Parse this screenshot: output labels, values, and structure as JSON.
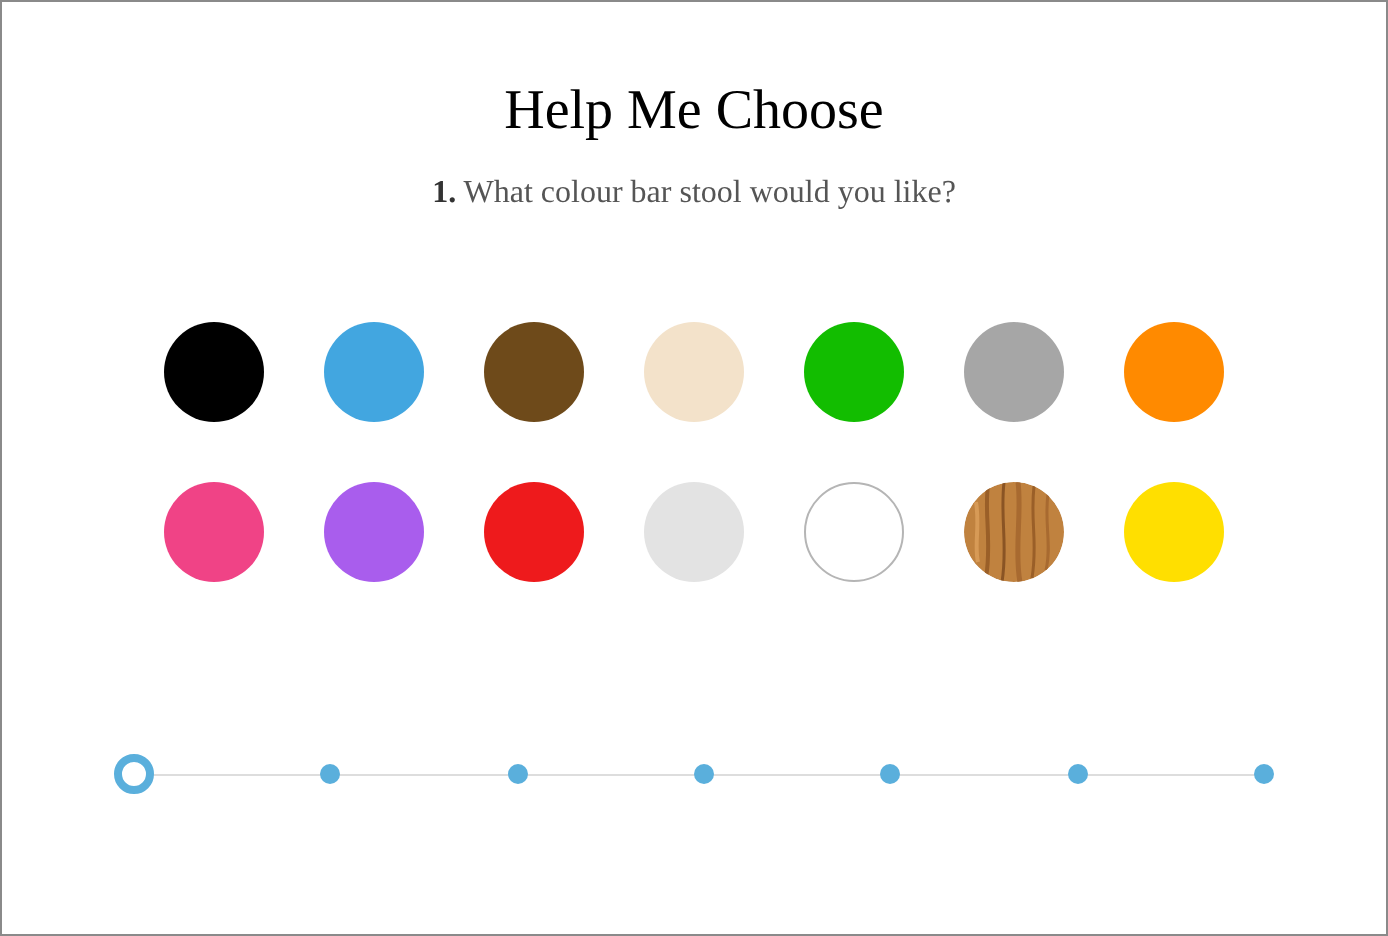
{
  "title": "Help Me Choose",
  "question": "**1.** What colour bar stool would you like?",
  "swatches": [
    {
      "kind": "solid",
      "color": "#000000"
    },
    {
      "kind": "solid",
      "color": "#42a6e0"
    },
    {
      "kind": "solid",
      "color": "#6e4a1a"
    },
    {
      "kind": "solid",
      "color": "#f3e2ca"
    },
    {
      "kind": "solid",
      "color": "#12bd00"
    },
    {
      "kind": "solid",
      "color": "#a6a6a6"
    },
    {
      "kind": "solid",
      "color": "#ff8a00"
    },
    {
      "kind": "solid",
      "color": "#f04386"
    },
    {
      "kind": "solid",
      "color": "#a95ded"
    },
    {
      "kind": "solid",
      "color": "#ee1a1c"
    },
    {
      "kind": "solid",
      "color": "#e3e3e3"
    },
    {
      "kind": "outline",
      "color": "#ffffff"
    },
    {
      "kind": "wood"
    },
    {
      "kind": "solid",
      "color": "#ffdf00"
    }
  ],
  "steps": [
    {
      "selected": true
    },
    {
      "selected": false
    },
    {
      "selected": false
    },
    {
      "selected": false
    },
    {
      "selected": false
    },
    {
      "selected": false
    },
    {
      "selected": false
    }
  ]
}
